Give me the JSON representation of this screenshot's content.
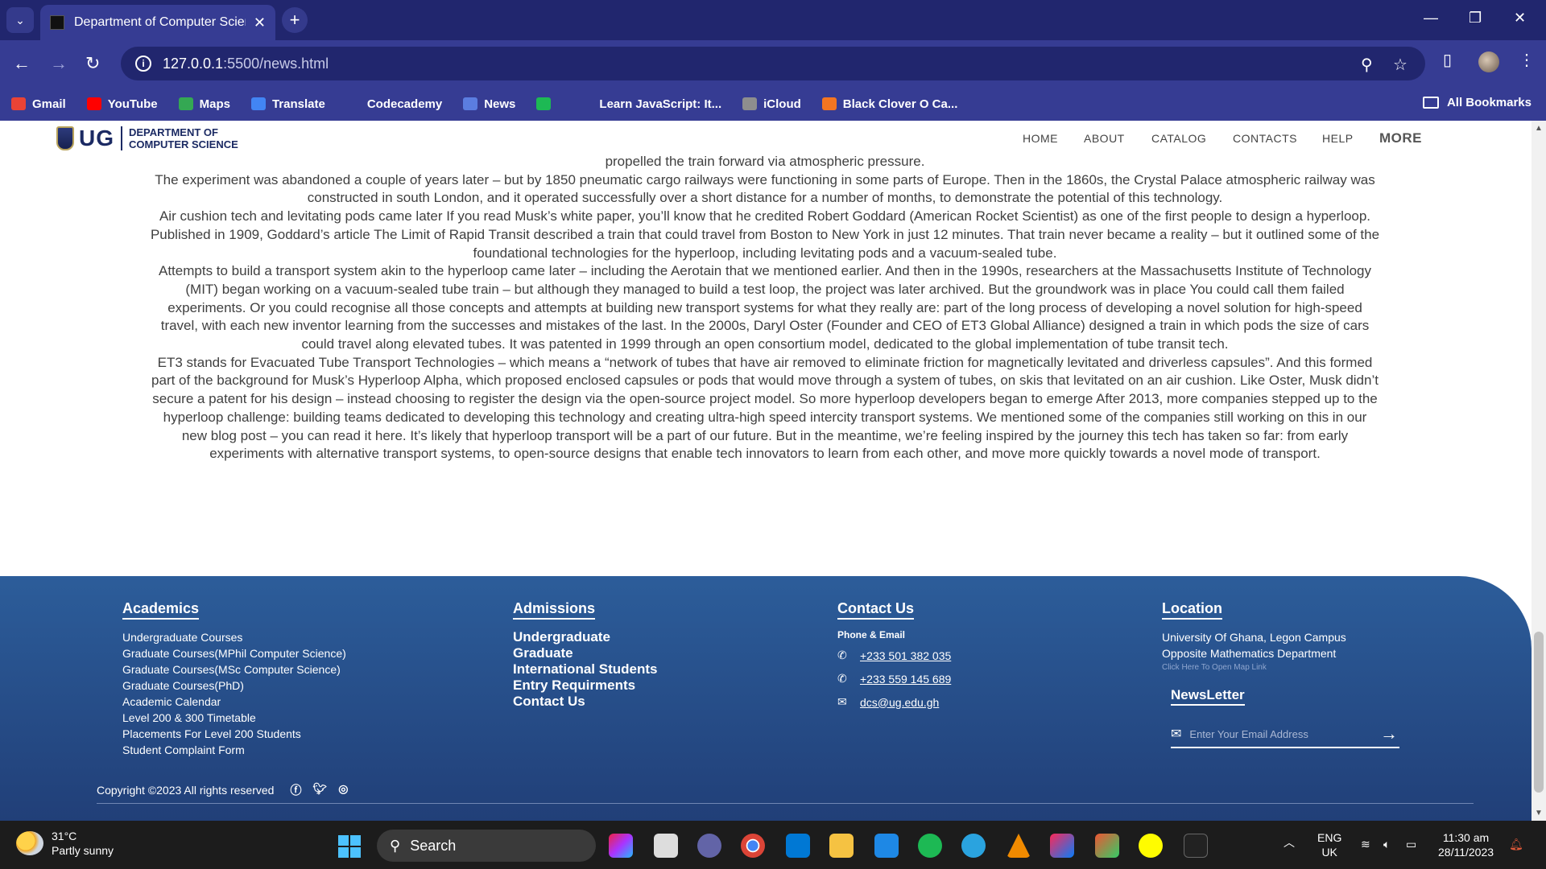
{
  "browser": {
    "tab_title": "Department of Computer Scien",
    "url_host": "127.0.0.1",
    "url_path": ":5500/news.html",
    "bookmarks": [
      {
        "label": "Gmail",
        "icon": "gmail-icon",
        "color": "#ea4335"
      },
      {
        "label": "YouTube",
        "icon": "youtube-icon",
        "color": "#ff0000"
      },
      {
        "label": "Maps",
        "icon": "maps-icon",
        "color": "#34a853"
      },
      {
        "label": "Translate",
        "icon": "translate-icon",
        "color": "#4285f4"
      },
      {
        "label": "Codecademy",
        "icon": "globe-icon",
        "color": "#363c93"
      },
      {
        "label": "News",
        "icon": "news-icon",
        "color": "#5b7de0"
      },
      {
        "label": "",
        "icon": "spotify-icon",
        "color": "#1db954"
      },
      {
        "label": "Learn JavaScript: It...",
        "icon": "globe-icon",
        "color": "#363c93"
      },
      {
        "label": "iCloud",
        "icon": "apple-icon",
        "color": "#8e8e8e"
      },
      {
        "label": "Black Clover O Ca...",
        "icon": "crunchyroll-icon",
        "color": "#f47521"
      }
    ],
    "all_bookmarks": "All Bookmarks"
  },
  "site": {
    "logo_short": "UG",
    "logo_line1": "DEPARTMENT OF",
    "logo_line2": "COMPUTER SCIENCE",
    "nav": [
      "HOME",
      "ABOUT",
      "CATALOG",
      "CONTACTS",
      "HELP",
      "MORE"
    ]
  },
  "article": {
    "lines": [
      "propelled the train forward via atmospheric pressure.",
      "The experiment was abandoned a couple of years later – but by 1850 pneumatic cargo railways were functioning in some parts of Europe. Then in the 1860s, the Crystal Palace atmospheric railway was constructed in south London, and it operated successfully over a short distance for a number of months, to demonstrate the potential of this technology.",
      "Air cushion tech and levitating pods came later If you read Musk’s white paper, you’ll know that he credited Robert Goddard (American Rocket Scientist) as one of the first people to design a hyperloop. Published in 1909, Goddard’s article The Limit of Rapid Transit described a train that could travel from Boston to New York in just 12 minutes. That train never became a reality – but it outlined some of the foundational technologies for the hyperloop, including levitating pods and a vacuum-sealed tube.",
      "Attempts to build a transport system akin to the hyperloop came later – including the Aerotain that we mentioned earlier. And then in the 1990s, researchers at the Massachusetts Institute of Technology (MIT) began working on a vacuum-sealed tube train – but although they managed to build a test loop, the project was later archived. But the groundwork was in place You could call them failed experiments. Or you could recognise all those concepts and attempts at building new transport systems for what they really are: part of the long process of developing a novel solution for high-speed travel, with each new inventor learning from the successes and mistakes of the last. In the 2000s, Daryl Oster (Founder and CEO of ET3 Global Alliance) designed a train in which pods the size of cars could travel along elevated tubes. It was patented in 1999 through an open consortium model, dedicated to the global implementation of tube transit tech.",
      "ET3 stands for Evacuated Tube Transport Technologies – which means a “network of tubes that have air removed to eliminate friction for magnetically levitated and driverless capsules”. And this formed part of the background for Musk’s Hyperloop Alpha, which proposed enclosed capsules or pods that would move through a system of tubes, on skis that levitated on an air cushion. Like Oster, Musk didn’t secure a patent for his design – instead choosing to register the design via the open-source project model. So more hyperloop developers began to emerge After 2013, more companies stepped up to the hyperloop challenge: building teams dedicated to developing this technology and creating ultra-high speed intercity transport systems. We mentioned some of the companies still working on this in our new blog post – you can read it here. It’s likely that hyperloop transport will be a part of our future. But in the meantime, we’re feeling inspired by the journey this tech has taken so far: from early experiments with alternative transport systems, to open-source designs that enable tech innovators to learn from each other, and move more quickly towards a novel mode of transport."
    ]
  },
  "footer": {
    "academics": {
      "title": "Academics",
      "links": [
        "Undergraduate Courses",
        "Graduate Courses(MPhil Computer Science)",
        "Graduate Courses(MSc Computer Science)",
        "Graduate Courses(PhD)",
        "Academic Calendar",
        "Level 200 & 300 Timetable",
        "Placements For Level 200 Students",
        "Student Complaint Form"
      ]
    },
    "admissions": {
      "title": "Admissions",
      "links": [
        "Undergraduate",
        "Graduate",
        "International Students",
        "Entry Requirments",
        "Contact Us"
      ]
    },
    "contact": {
      "title": "Contact Us",
      "subtitle": "Phone & Email",
      "phone1": "+233 501 382 035",
      "phone2": "+233 559 145 689",
      "email": "dcs@ug.edu.gh"
    },
    "location": {
      "title": "Location",
      "line1": "University Of Ghana, Legon Campus",
      "line2": "Opposite Mathematics Department",
      "map_link": "Click Here To Open Map Link"
    },
    "newsletter": {
      "title": "NewsLetter",
      "placeholder": "Enter Your Email Address"
    },
    "copyright": "Copyright ©2023 All rights reserved"
  },
  "taskbar": {
    "temp": "31°C",
    "condition": "Partly sunny",
    "search": "Search",
    "lang1": "ENG",
    "lang2": "UK",
    "time": "11:30 am",
    "date": "28/11/2023"
  }
}
